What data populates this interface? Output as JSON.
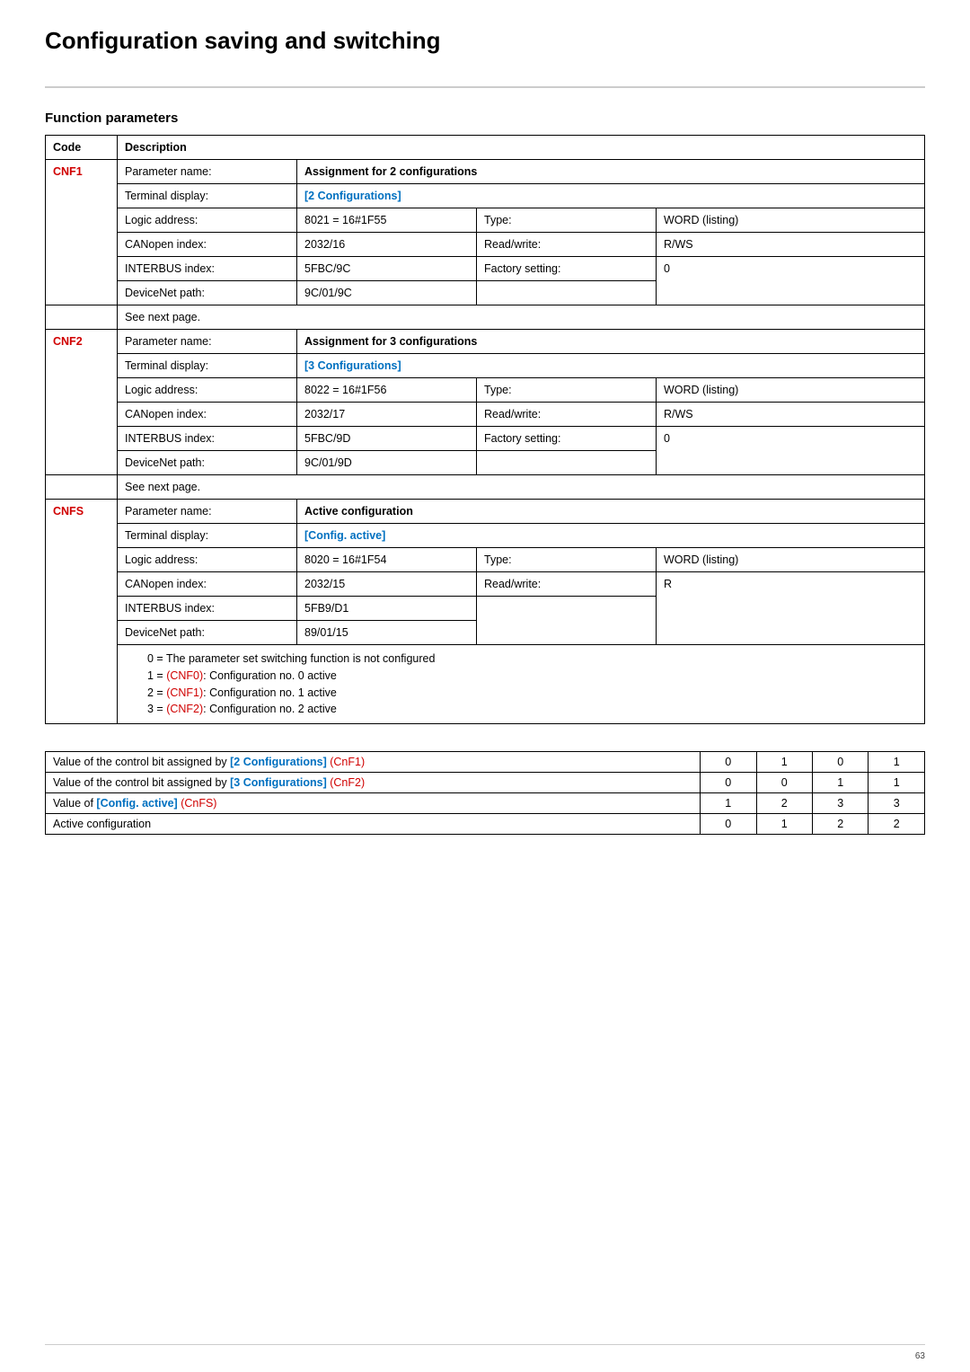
{
  "title": "Configuration saving and switching",
  "section": "Function parameters",
  "headers": {
    "code": "Code",
    "description": "Description"
  },
  "labels": {
    "param_name": "Parameter name:",
    "term_disp": "Terminal display:",
    "logic_addr": "Logic address:",
    "canopen": "CANopen index:",
    "interbus": "INTERBUS index:",
    "devicenet": "DeviceNet path:",
    "type": "Type:",
    "rw": "Read/write:",
    "factory": "Factory setting:"
  },
  "params": [
    {
      "code": "CNF1",
      "param_name": "Assignment for 2 configurations",
      "term_disp": "[2 Configurations]",
      "logic_addr": "8021 = 16#1F55",
      "canopen": "2032/16",
      "interbus": "5FBC/9C",
      "devicenet": "9C/01/9C",
      "type": "WORD (listing)",
      "rw": "R/WS",
      "factory": "0",
      "note": "See next page."
    },
    {
      "code": "CNF2",
      "param_name": "Assignment for 3 configurations",
      "term_disp": "[3 Configurations]",
      "logic_addr": "8022 = 16#1F56",
      "canopen": "2032/17",
      "interbus": "5FBC/9D",
      "devicenet": "9C/01/9D",
      "type": "WORD (listing)",
      "rw": "R/WS",
      "factory": "0",
      "note": "See next page."
    },
    {
      "code": "CNFS",
      "param_name": "Active configuration",
      "term_disp": "[Config. active]",
      "logic_addr": "8020 = 16#1F54",
      "canopen": "2032/15",
      "interbus": "5FB9/D1",
      "devicenet": "89/01/15",
      "type": "WORD (listing)",
      "rw": "R",
      "factory": "",
      "values": {
        "l0": "0 = The parameter set switching function is not configured",
        "l1a": "1 = ",
        "l1code": "(CNF0)",
        "l1b": ": Configuration no. 0 active",
        "l2a": "2 = ",
        "l2code": "(CNF1)",
        "l2b": ": Configuration no. 1 active",
        "l3a": "3 = ",
        "l3code": "(CNF2)",
        "l3b": ": Configuration no. 2 active"
      }
    }
  ],
  "truth": {
    "rows": [
      {
        "pre": "Value of the control bit assigned by ",
        "bold": "[2 Configurations] ",
        "code": "(CnF1)",
        "vals": [
          "0",
          "1",
          "0",
          "1"
        ]
      },
      {
        "pre": "Value of the control bit assigned by ",
        "bold": "[3 Configurations] ",
        "code": "(CnF2)",
        "vals": [
          "0",
          "0",
          "1",
          "1"
        ]
      },
      {
        "pre": "Value of ",
        "bold": "[Config. active] ",
        "code": "(CnFS)",
        "vals": [
          "1",
          "2",
          "3",
          "3"
        ]
      },
      {
        "pre": "Active configuration",
        "bold": "",
        "code": "",
        "vals": [
          "0",
          "1",
          "2",
          "2"
        ]
      }
    ]
  },
  "page_number": "63"
}
